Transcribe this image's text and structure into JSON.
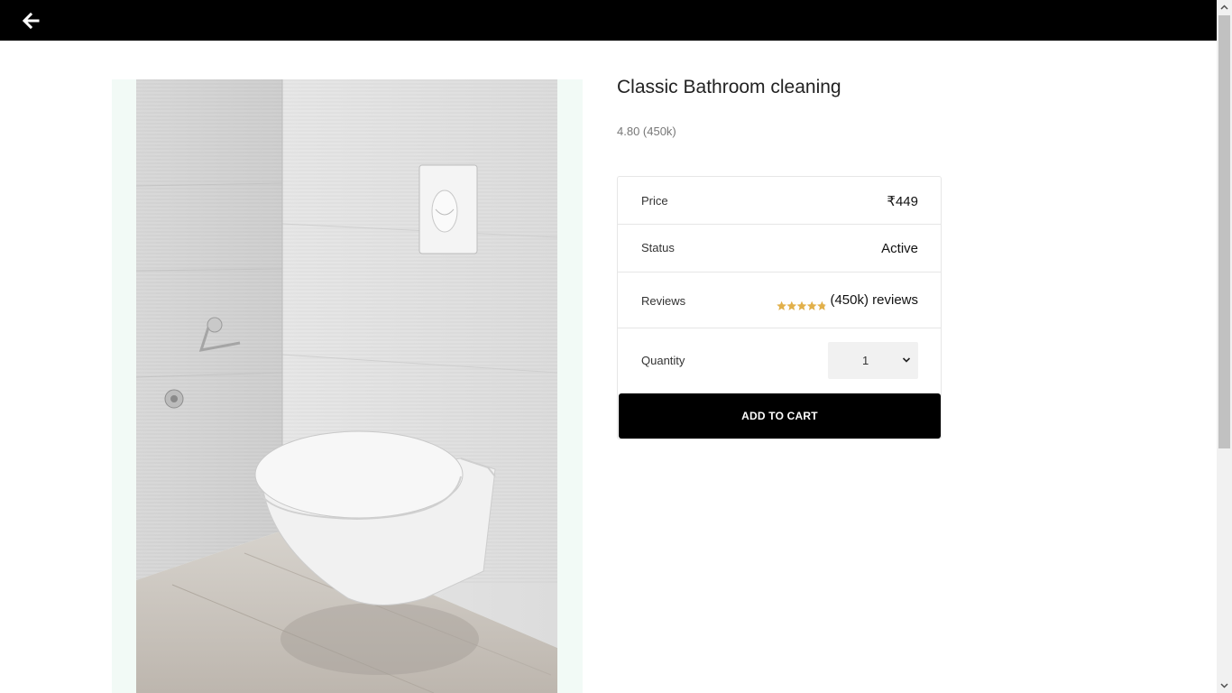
{
  "header": {
    "back_icon": "arrow-left-icon"
  },
  "product": {
    "title": "Classic Bathroom cleaning",
    "rating_summary": "4.80 (450k)",
    "rating": 4.8,
    "image_alt_subject": "wall-mounted toilet in tiled bathroom"
  },
  "details": {
    "price_label": "Price",
    "price_value": "₹449",
    "status_label": "Status",
    "status_value": "Active",
    "reviews_label": "Reviews",
    "reviews_value": "(450k) reviews",
    "quantity_label": "Quantity",
    "quantity_value": "1"
  },
  "actions": {
    "add_to_cart_label": "ADD TO CART"
  },
  "colors": {
    "header_bg": "#000000",
    "image_panel_bg": "#f2faf6",
    "star_color": "#e2b04a",
    "button_bg": "#000000",
    "button_text": "#ffffff"
  }
}
